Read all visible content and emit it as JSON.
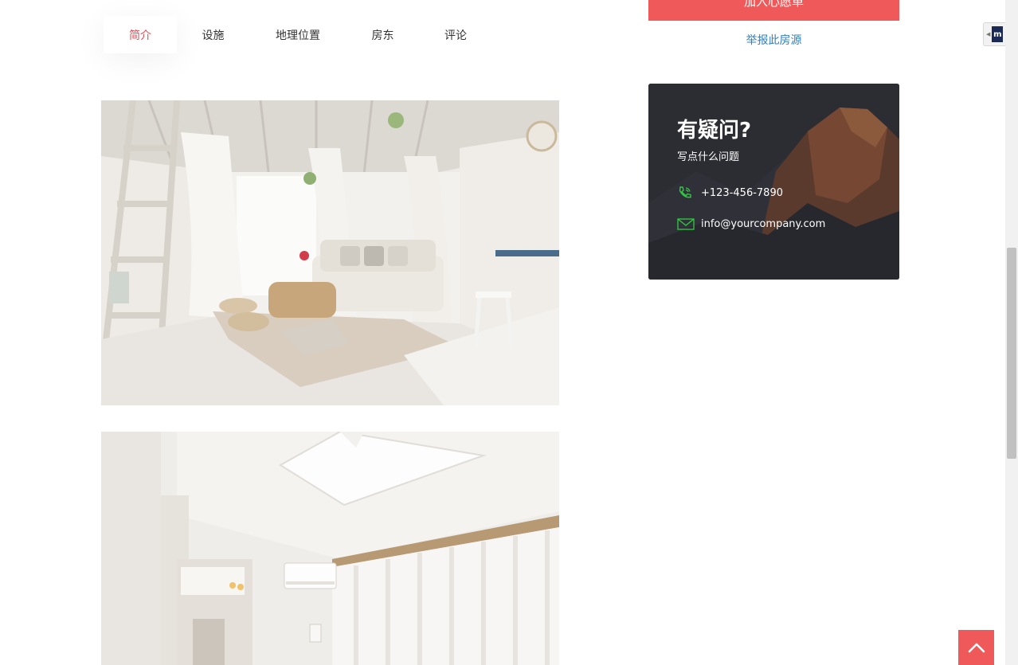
{
  "tabs": [
    {
      "label": "简介",
      "active": true
    },
    {
      "label": "设施",
      "active": false
    },
    {
      "label": "地理位置",
      "active": false
    },
    {
      "label": "房东",
      "active": false
    },
    {
      "label": "评论",
      "active": false
    }
  ],
  "sidebar": {
    "wishlist_label": "加入心愿单",
    "report_link": "举报此房源"
  },
  "contact": {
    "title": "有疑问?",
    "subtitle": "写点什么问题",
    "phone": "+123-456-7890",
    "email": "info@yourcompany.com"
  },
  "widgets": {
    "side_tab_logo": "m"
  },
  "colors": {
    "accent": "#f0595a",
    "active_tab": "#e24d56",
    "link": "#2f7fc1",
    "icon_green": "#2ecc40"
  },
  "icons": {
    "phone": "phone-icon",
    "email": "envelope-icon",
    "back_to_top": "chevron-up-icon"
  }
}
